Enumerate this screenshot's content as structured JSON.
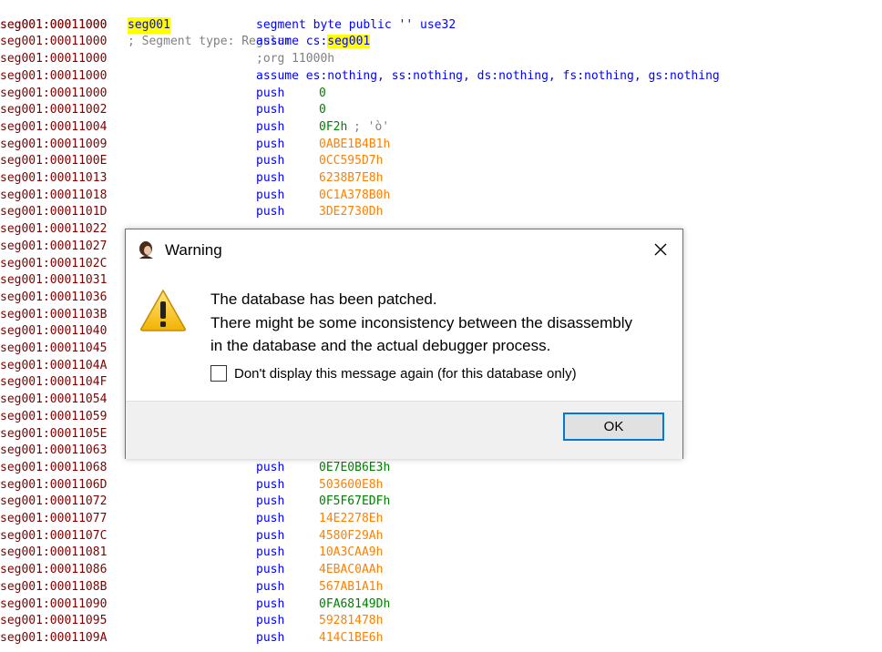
{
  "listing": {
    "header_comment": "; Segment type: Regular",
    "lines": [
      {
        "addr": "seg001:00011000",
        "label": "seg001",
        "mnem": "segment byte public '' use32",
        "op": "",
        "opc": ""
      },
      {
        "addr": "seg001:00011000",
        "label": "",
        "mnem": "assume cs:",
        "op": "seg001",
        "opc": "hl"
      },
      {
        "addr": "seg001:00011000",
        "label": "",
        "mnem": ";org 11000h",
        "op": "",
        "opc": "gray"
      },
      {
        "addr": "seg001:00011000",
        "label": "",
        "mnem": "assume es:nothing, ss:nothing, ds:nothing, fs:nothing, gs:nothing",
        "op": "",
        "opc": ""
      },
      {
        "addr": "seg001:00011000",
        "label": "",
        "mnem": "push",
        "op": "0",
        "opc": "green"
      },
      {
        "addr": "seg001:00011002",
        "label": "",
        "mnem": "push",
        "op": "0",
        "opc": "green"
      },
      {
        "addr": "seg001:00011004",
        "label": "",
        "mnem": "push",
        "op": "0F2h",
        "opc": "green",
        "cmt": "; 'ò'"
      },
      {
        "addr": "seg001:00011009",
        "label": "",
        "mnem": "push",
        "op": "0ABE1B4B1h",
        "opc": "orange"
      },
      {
        "addr": "seg001:0001100E",
        "label": "",
        "mnem": "push",
        "op": "0CC595D7h",
        "opc": "orange"
      },
      {
        "addr": "seg001:00011013",
        "label": "",
        "mnem": "push",
        "op": "6238B7E8h",
        "opc": "orange"
      },
      {
        "addr": "seg001:00011018",
        "label": "",
        "mnem": "push",
        "op": "0C1A378B0h",
        "opc": "orange"
      },
      {
        "addr": "seg001:0001101D",
        "label": "",
        "mnem": "push",
        "op": "3DE2730Dh",
        "opc": "orange"
      },
      {
        "addr": "seg001:00011022",
        "label": "",
        "mnem": "",
        "op": "",
        "opc": ""
      },
      {
        "addr": "seg001:00011027",
        "label": "",
        "mnem": "",
        "op": "",
        "opc": ""
      },
      {
        "addr": "seg001:0001102C",
        "label": "",
        "mnem": "",
        "op": "",
        "opc": ""
      },
      {
        "addr": "seg001:00011031",
        "label": "",
        "mnem": "",
        "op": "",
        "opc": ""
      },
      {
        "addr": "seg001:00011036",
        "label": "",
        "mnem": "",
        "op": "",
        "opc": ""
      },
      {
        "addr": "seg001:0001103B",
        "label": "",
        "mnem": "",
        "op": "",
        "opc": ""
      },
      {
        "addr": "seg001:00011040",
        "label": "",
        "mnem": "",
        "op": "",
        "opc": ""
      },
      {
        "addr": "seg001:00011045",
        "label": "",
        "mnem": "",
        "op": "",
        "opc": ""
      },
      {
        "addr": "seg001:0001104A",
        "label": "",
        "mnem": "",
        "op": "",
        "opc": ""
      },
      {
        "addr": "seg001:0001104F",
        "label": "",
        "mnem": "",
        "op": "",
        "opc": ""
      },
      {
        "addr": "seg001:00011054",
        "label": "",
        "mnem": "",
        "op": "",
        "opc": ""
      },
      {
        "addr": "seg001:00011059",
        "label": "",
        "mnem": "",
        "op": "",
        "opc": ""
      },
      {
        "addr": "seg001:0001105E",
        "label": "",
        "mnem": "",
        "op": "",
        "opc": ""
      },
      {
        "addr": "seg001:00011063",
        "label": "",
        "mnem": "",
        "op": "",
        "opc": ""
      },
      {
        "addr": "seg001:00011068",
        "label": "",
        "mnem": "push",
        "op": "0E7E0B6E3h",
        "opc": "green"
      },
      {
        "addr": "seg001:0001106D",
        "label": "",
        "mnem": "push",
        "op": "503600E8h",
        "opc": "orange"
      },
      {
        "addr": "seg001:00011072",
        "label": "",
        "mnem": "push",
        "op": "0F5F67EDFh",
        "opc": "green"
      },
      {
        "addr": "seg001:00011077",
        "label": "",
        "mnem": "push",
        "op": "14E2278Eh",
        "opc": "orange"
      },
      {
        "addr": "seg001:0001107C",
        "label": "",
        "mnem": "push",
        "op": "4580F29Ah",
        "opc": "orange"
      },
      {
        "addr": "seg001:00011081",
        "label": "",
        "mnem": "push",
        "op": "10A3CAA9h",
        "opc": "orange"
      },
      {
        "addr": "seg001:00011086",
        "label": "",
        "mnem": "push",
        "op": "4EBAC0AAh",
        "opc": "orange"
      },
      {
        "addr": "seg001:0001108B",
        "label": "",
        "mnem": "push",
        "op": "567AB1A1h",
        "opc": "orange"
      },
      {
        "addr": "seg001:00011090",
        "label": "",
        "mnem": "push",
        "op": "0FA68149Dh",
        "opc": "green"
      },
      {
        "addr": "seg001:00011095",
        "label": "",
        "mnem": "push",
        "op": "59281478h",
        "opc": "orange"
      },
      {
        "addr": "seg001:0001109A",
        "label": "",
        "mnem": "push",
        "op": "414C1BE6h",
        "opc": "orange"
      }
    ]
  },
  "dialog": {
    "title": "Warning",
    "message_line1": "The database has been patched.",
    "message_line2": "There might be some inconsistency between the disassembly",
    "message_line3": "in the database and the actual debugger process.",
    "checkbox_label": "Don't display this message again (for this database only)",
    "checkbox_checked": false,
    "ok_label": "OK",
    "app_icon": "ida-app-icon",
    "warning_icon": "warning-triangle-icon",
    "close_icon": "close-icon"
  },
  "colors": {
    "address": "#800000",
    "keyword": "#0000ff",
    "highlight": "#ffff00",
    "number_green": "#008000",
    "number_orange": "#ff8000",
    "comment": "#808080",
    "accent": "#0078d7"
  }
}
